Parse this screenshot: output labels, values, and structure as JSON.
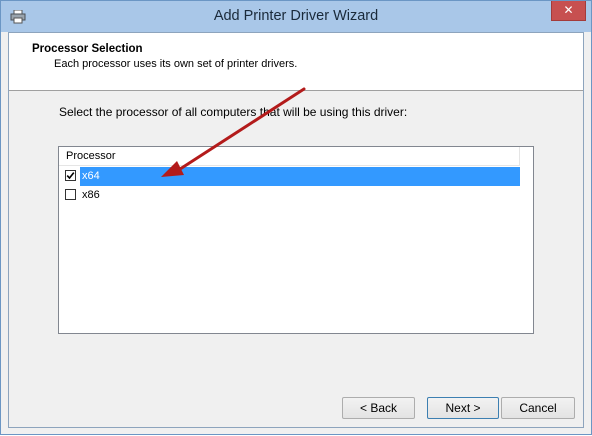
{
  "window": {
    "title": "Add Printer Driver Wizard",
    "close_glyph": "✕",
    "icon": "printer-icon"
  },
  "header": {
    "title": "Processor Selection",
    "subtitle": "Each processor uses its own set of printer drivers."
  },
  "instruction": "Select the processor of all computers that will be using this driver:",
  "list": {
    "column_header": "Processor",
    "items": [
      {
        "label": "x64",
        "checked": true,
        "selected": true
      },
      {
        "label": "x86",
        "checked": false,
        "selected": false
      }
    ]
  },
  "buttons": {
    "back": "< Back",
    "next": "Next >",
    "cancel": "Cancel"
  },
  "colors": {
    "selection": "#3399ff",
    "annotation_arrow": "#b31b1b",
    "titlebar": "#a9c7e8",
    "close_button": "#c75050"
  }
}
